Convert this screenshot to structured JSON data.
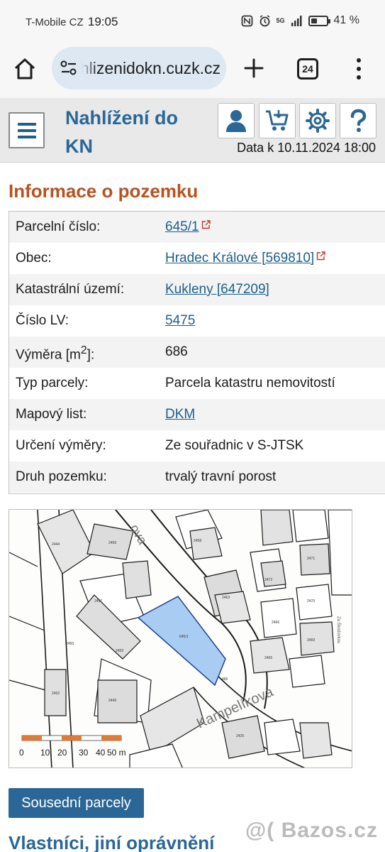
{
  "statusbar": {
    "carrier": "T-Mobile CZ",
    "time": "19:05",
    "network": "5G",
    "battery_percent": "41 %",
    "battery_level": 0.41
  },
  "browser": {
    "url": "nahlizenidokn.cuzk.cz",
    "tab_count": "24"
  },
  "header": {
    "title": "Nahlížení do KN",
    "data_date": "Data k 10.11.2024 18:00",
    "accent": "#2a6796"
  },
  "parcel": {
    "section_title": "Informace o pozemku",
    "rows": [
      {
        "label": "Parcelní číslo:",
        "value": "645/1"
      },
      {
        "label": "Obec:",
        "value": "Hradec Králové [569810]"
      },
      {
        "label": "Katastrální území:",
        "value": "Kukleny [647209]"
      },
      {
        "label": "Číslo LV:",
        "value": "5475"
      },
      {
        "label_main": "Výměra [m",
        "label_sup": "2",
        "label_end": "]:",
        "value": "686"
      },
      {
        "label": "Typ parcely:",
        "value": "Parcela katastru nemovitostí"
      },
      {
        "label": "Mapový list:",
        "value": "DKM"
      },
      {
        "label": "Určení výměry:",
        "value": "Ze souřadnic v S-JTSK"
      },
      {
        "label": "Druh pozemku:",
        "value": "trvalý travní porost"
      }
    ]
  },
  "map": {
    "street_label": "Kampelíkova",
    "street_label_top": "ova",
    "street_label_right": "Za Škodovkou",
    "highlight_color": "#a9cdf2",
    "scale_labels": [
      "0",
      "10",
      "20",
      "30",
      "40",
      "50 m"
    ]
  },
  "buttons": {
    "neighbors": "Sousední parcely"
  },
  "owners": {
    "title": "Vlastníci, jiní oprávnění"
  },
  "watermark": "@( Bazos.cz"
}
